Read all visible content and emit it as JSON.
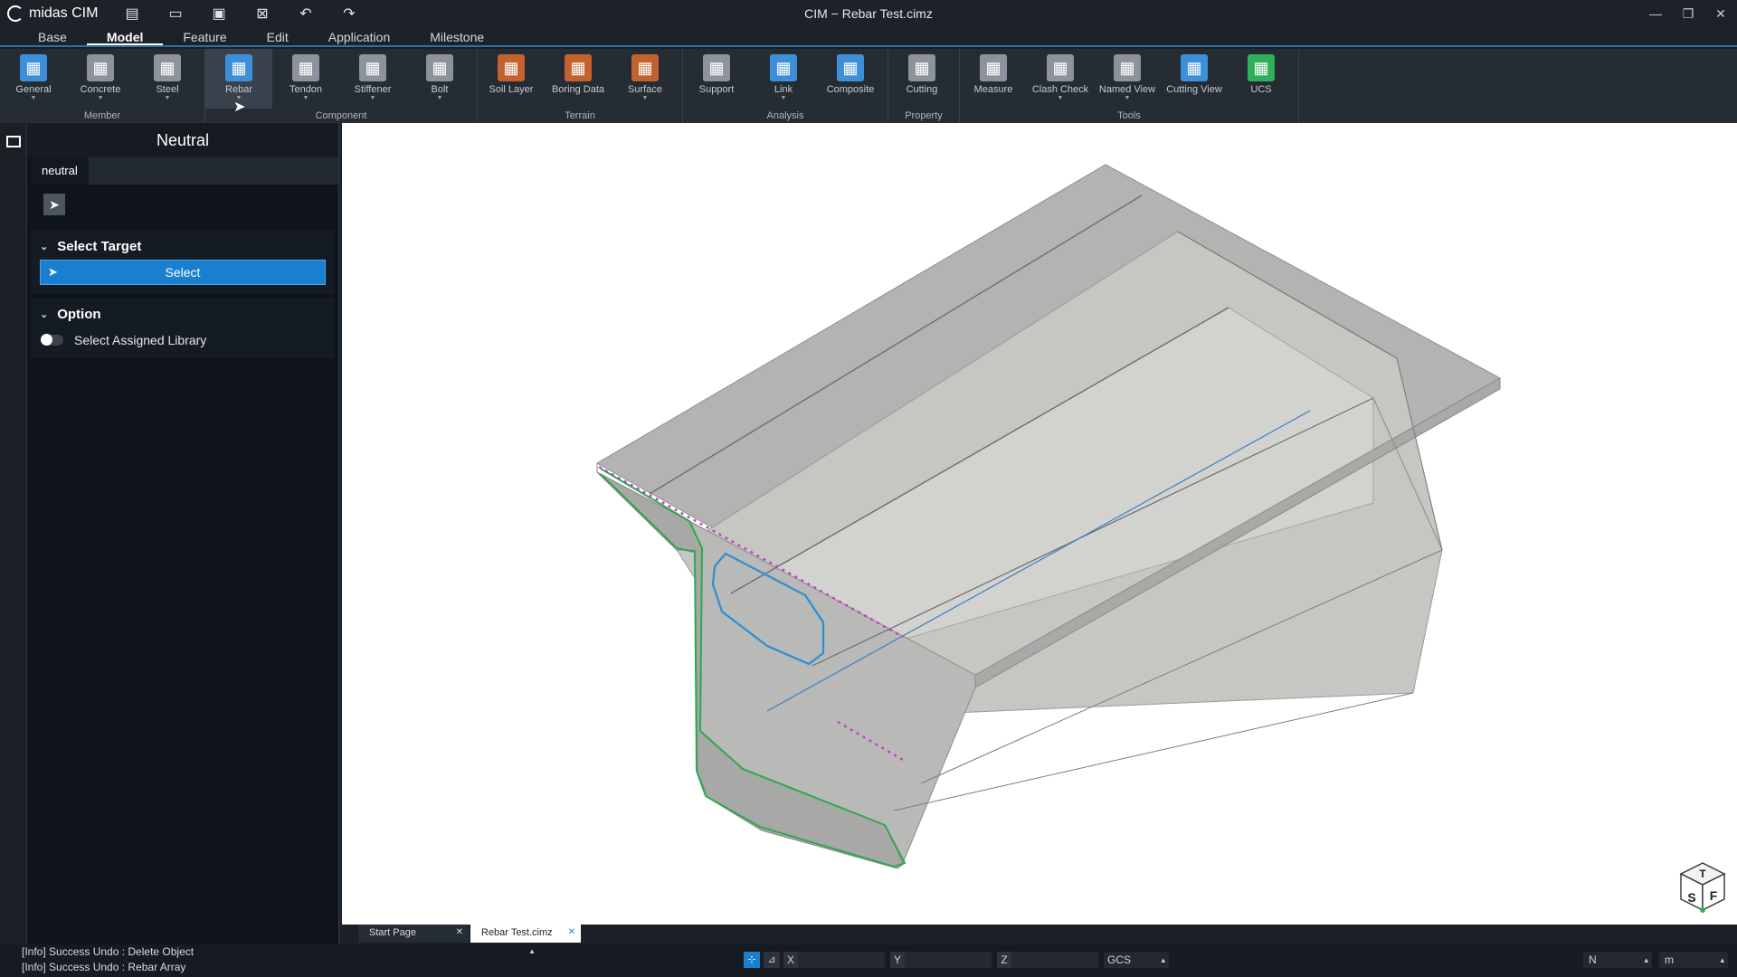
{
  "app": {
    "logo_text": "midas CIM",
    "window_title": "CIM − Rebar Test.cimz",
    "quick_access": [
      "new-file-icon",
      "open-folder-icon",
      "save-icon",
      "close-file-icon",
      "undo-icon",
      "redo-icon"
    ],
    "window_controls": [
      "minimize-icon",
      "restore-icon",
      "close-icon"
    ]
  },
  "menu": {
    "tabs": [
      "Base",
      "Model",
      "Feature",
      "Edit",
      "Application",
      "Milestone"
    ],
    "active": "Model"
  },
  "ribbon": {
    "groups": [
      {
        "label": "Member",
        "buttons": [
          {
            "label": "General",
            "icon": "general-icon",
            "color": "#3d8fd8",
            "dropdown": true
          },
          {
            "label": "Concrete",
            "icon": "concrete-icon",
            "color": "#8c939c",
            "dropdown": true
          },
          {
            "label": "Steel",
            "icon": "steel-icon",
            "color": "#8c939c",
            "dropdown": true
          }
        ]
      },
      {
        "label": "Component",
        "buttons": [
          {
            "label": "Rebar",
            "icon": "rebar-icon",
            "color": "#3d8fd8",
            "dropdown": true
          },
          {
            "label": "Tendon",
            "icon": "tendon-icon",
            "color": "#8c939c",
            "dropdown": true
          },
          {
            "label": "Stiffener",
            "icon": "stiffener-icon",
            "color": "#8c939c",
            "dropdown": true
          },
          {
            "label": "Bolt",
            "icon": "bolt-icon",
            "color": "#8c939c",
            "dropdown": true
          }
        ]
      },
      {
        "label": "Terrain",
        "buttons": [
          {
            "label": "Soil Layer",
            "icon": "soil-layer-icon",
            "color": "#c2622e",
            "dropdown": false
          },
          {
            "label": "Boring Data",
            "icon": "boring-data-icon",
            "color": "#c2622e",
            "dropdown": false
          },
          {
            "label": "Surface",
            "icon": "surface-icon",
            "color": "#c2622e",
            "dropdown": true
          }
        ]
      },
      {
        "label": "Analysis",
        "buttons": [
          {
            "label": "Support",
            "icon": "support-icon",
            "color": "#8c939c",
            "dropdown": false
          },
          {
            "label": "Link",
            "icon": "link-icon",
            "color": "#3d8fd8",
            "dropdown": true
          },
          {
            "label": "Composite",
            "icon": "composite-icon",
            "color": "#3d8fd8",
            "dropdown": false
          }
        ]
      },
      {
        "label": "Property",
        "buttons": [
          {
            "label": "Cutting",
            "icon": "cutting-icon",
            "color": "#8c939c",
            "dropdown": false
          }
        ]
      },
      {
        "label": "Tools",
        "buttons": [
          {
            "label": "Measure",
            "icon": "measure-icon",
            "color": "#8c939c",
            "dropdown": false
          },
          {
            "label": "Clash Check",
            "icon": "clash-check-icon",
            "color": "#8c939c",
            "dropdown": true
          },
          {
            "label": "Named View",
            "icon": "named-view-icon",
            "color": "#8c939c",
            "dropdown": true
          },
          {
            "label": "Cutting View",
            "icon": "cutting-view-icon",
            "color": "#3d8fd8",
            "dropdown": false
          },
          {
            "label": "UCS",
            "icon": "ucs-icon",
            "color": "#2fae5b",
            "dropdown": false
          }
        ]
      }
    ]
  },
  "panel": {
    "title": "Neutral",
    "tab": "neutral",
    "select_target": {
      "heading": "Select Target",
      "button": "Select"
    },
    "option": {
      "heading": "Option",
      "toggle_label": "Select Assigned Library",
      "toggle_on": false
    }
  },
  "viewcube": {
    "top": "T",
    "front_left": "S",
    "front_right": "F"
  },
  "doc_tabs": [
    {
      "label": "Start Page",
      "active": false
    },
    {
      "label": "Rebar Test.cimz",
      "active": true
    }
  ],
  "status": {
    "log": [
      "[Info] Success Undo : Delete Object",
      "[Info] Success Undo : Rebar Array"
    ],
    "coord_labels": [
      "X",
      "Y",
      "Z"
    ],
    "coord_system": "GCS",
    "force_unit": "N",
    "length_unit": "m"
  },
  "colors": {
    "accent": "#1b7fd1",
    "rebar_outer": "#2fa84f",
    "rebar_inner": "#2b8fd6",
    "rebar_top": "#c43cc9"
  }
}
